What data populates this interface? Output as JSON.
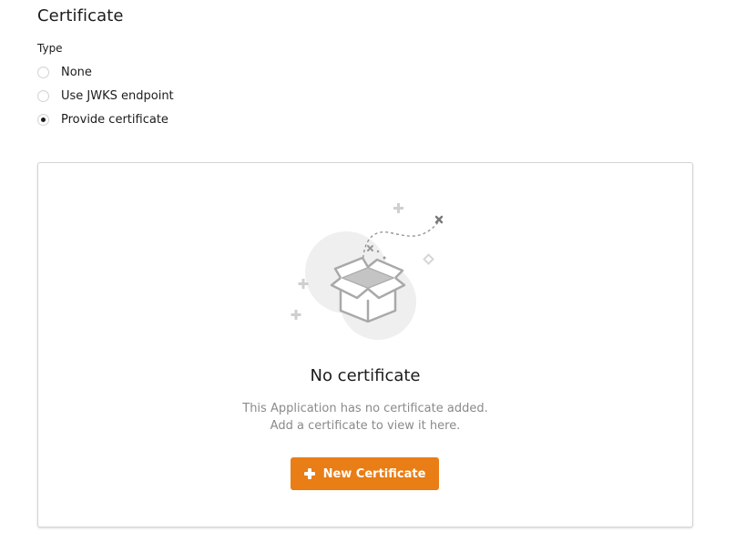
{
  "section": {
    "title": "Certificate",
    "type_label": "Type"
  },
  "type_options": [
    {
      "label": "None",
      "selected": false
    },
    {
      "label": "Use JWKS endpoint",
      "selected": false
    },
    {
      "label": "Provide certificate",
      "selected": true
    }
  ],
  "empty_state": {
    "icon": "open-box-icon",
    "title": "No certificate",
    "description_line1": "This Application has no certificate added.",
    "description_line2": "Add a certificate to view it here.",
    "button_label": "New Certificate",
    "button_icon": "plus-icon"
  },
  "colors": {
    "accent": "#e97d16",
    "text": "#1b1c1d",
    "muted_text": "#8a8a8a",
    "border": "#d4d4d5"
  }
}
